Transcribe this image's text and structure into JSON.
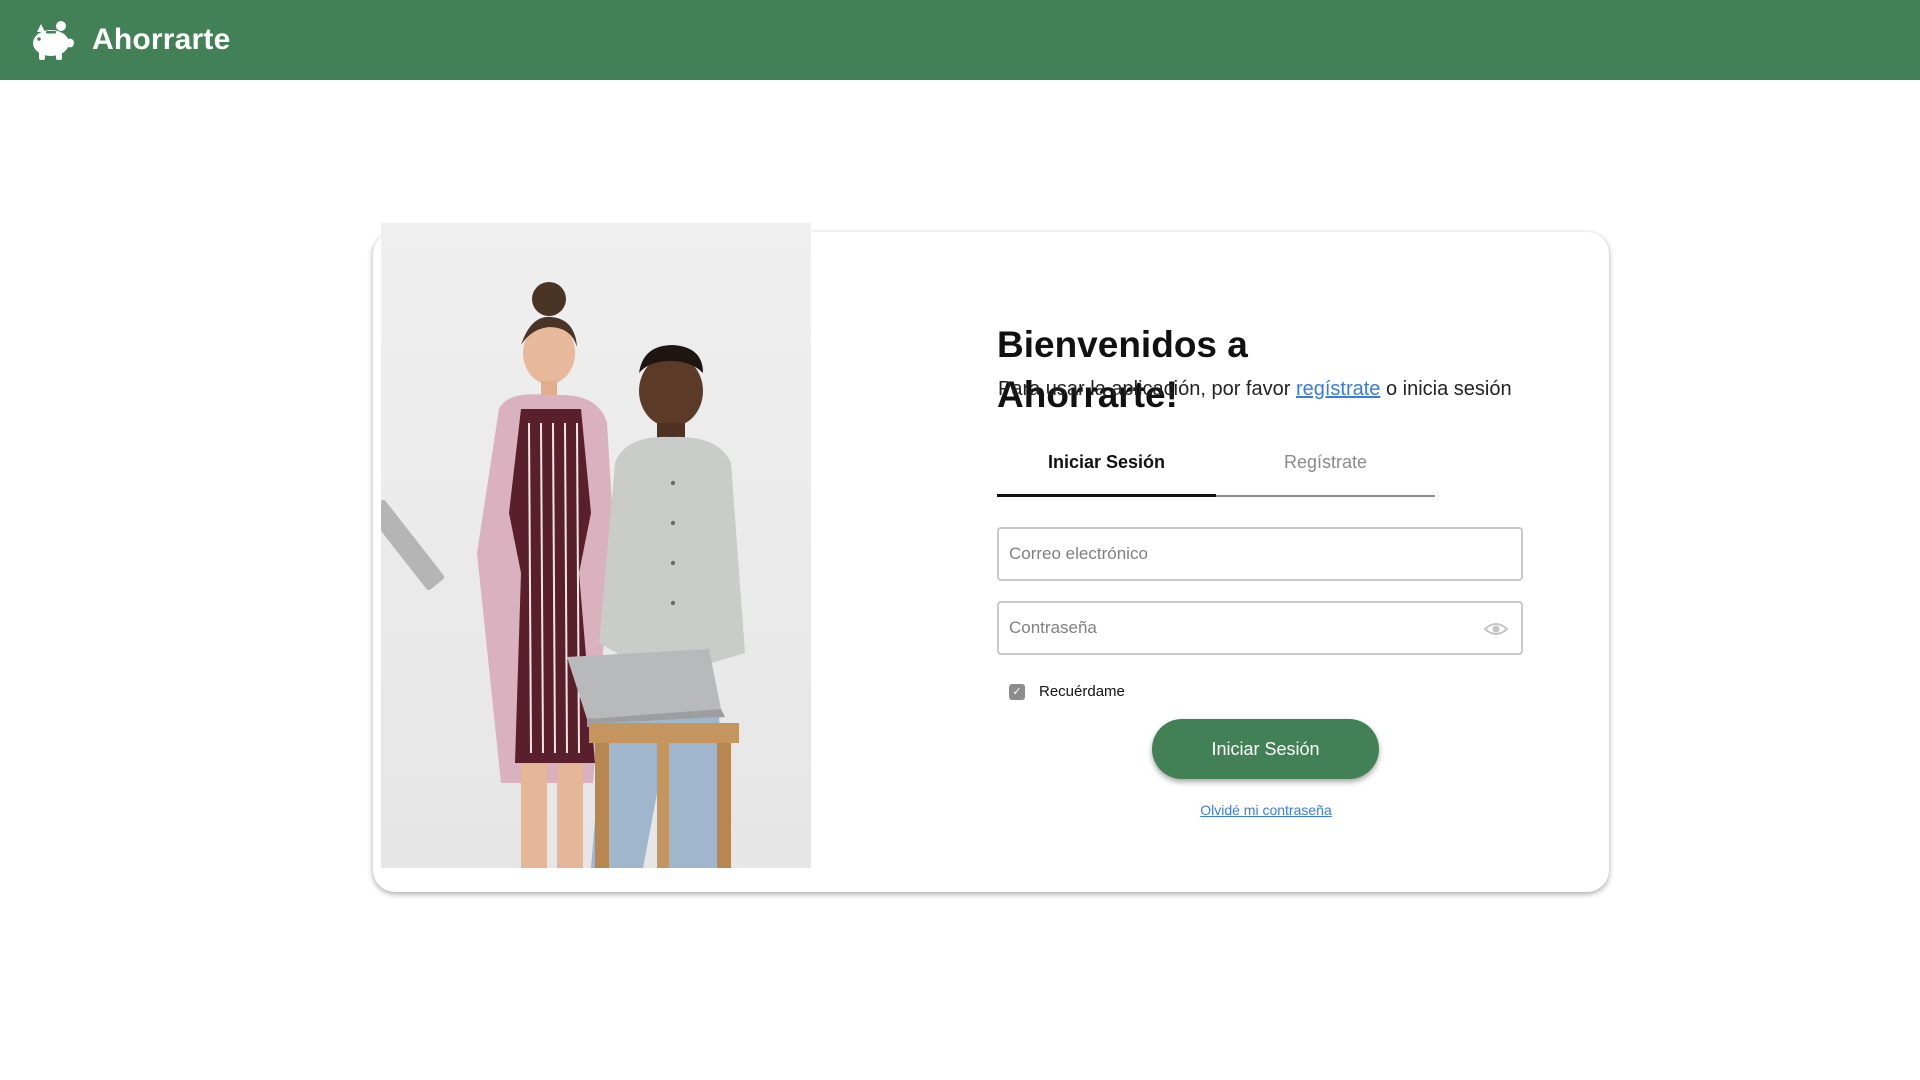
{
  "header": {
    "brand": "Ahorrarte",
    "logo_icon": "piggy-bank-icon",
    "background_color": "#428155"
  },
  "login": {
    "welcome_title": "Bienvenidos a Ahorrarte!",
    "subtitle_prefix": "Para usar la aplicación, por favor ",
    "subtitle_link": "regístrate",
    "subtitle_suffix": " o inicia sesión",
    "tabs": [
      {
        "label": "Iniciar Sesión",
        "active": true
      },
      {
        "label": "Regístrate",
        "active": false
      }
    ],
    "email_placeholder": "Correo electrónico",
    "password_placeholder": "Contraseña",
    "password_toggle_icon": "eye-icon",
    "remember_label": "Recuérdame",
    "remember_checked": true,
    "submit_label": "Iniciar Sesión",
    "forgot_label": "Olvidé mi contraseña",
    "accent_color": "#428155",
    "link_color": "#3a7be0"
  }
}
